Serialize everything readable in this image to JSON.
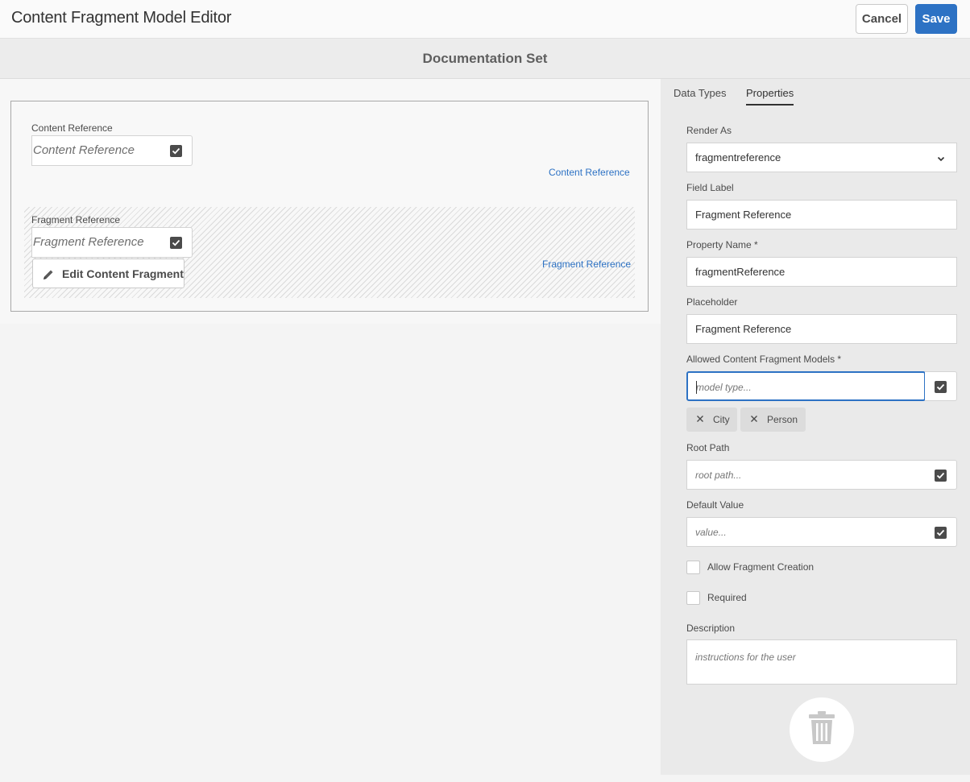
{
  "header": {
    "title": "Content Fragment Model Editor",
    "cancel_label": "Cancel",
    "save_label": "Save"
  },
  "model": {
    "name": "Documentation Set",
    "fields": [
      {
        "label": "Content Reference",
        "placeholder": "Content Reference",
        "link": "Content Reference"
      },
      {
        "label": "Fragment Reference",
        "placeholder": "Fragment Reference",
        "link": "Fragment Reference",
        "edit_label": "Edit Content Fragment"
      }
    ]
  },
  "panel": {
    "tabs": [
      "Data Types",
      "Properties"
    ],
    "active_tab": "Properties",
    "render_as": {
      "label": "Render As",
      "value": "fragmentreference"
    },
    "field_label": {
      "label": "Field Label",
      "value": "Fragment Reference"
    },
    "property_name": {
      "label": "Property Name *",
      "value": "fragmentReference"
    },
    "placeholder": {
      "label": "Placeholder",
      "value": "Fragment Reference"
    },
    "allowed_models": {
      "label": "Allowed Content Fragment Models *",
      "placeholder": "model type...",
      "tags": [
        "City",
        "Person"
      ]
    },
    "root_path": {
      "label": "Root Path",
      "placeholder": "root path..."
    },
    "default_value": {
      "label": "Default Value",
      "placeholder": "value..."
    },
    "allow_creation": {
      "label": "Allow Fragment Creation",
      "checked": false
    },
    "required": {
      "label": "Required",
      "checked": false
    },
    "description": {
      "label": "Description",
      "placeholder": "instructions for the user"
    }
  },
  "colors": {
    "accent": "#2d72c4",
    "panel_bg": "#eaeaea",
    "canvas_bg": "#f4f4f4"
  }
}
